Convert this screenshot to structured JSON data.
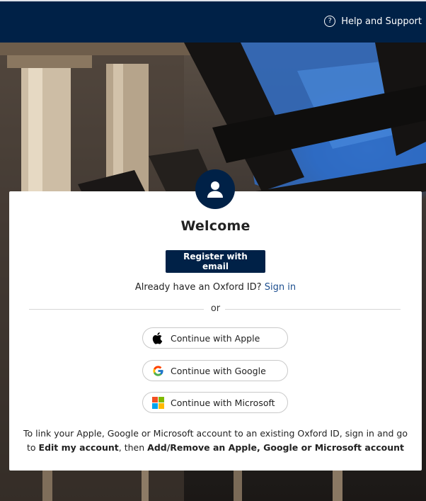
{
  "header": {
    "help_label": "Help and Support",
    "background_color": "#002147"
  },
  "hero": {
    "description": "Photo background of stone columns and iron railings",
    "sky_color": "#2a63b8"
  },
  "card": {
    "title": "Welcome",
    "register_label": "Register with email",
    "signin_prompt": "Already have an Oxford ID?",
    "signin_link": "Sign in",
    "or_label": "or",
    "providers": [
      {
        "label": "Continue with Apple",
        "icon": "apple-icon"
      },
      {
        "label": "Continue with Google",
        "icon": "google-icon"
      },
      {
        "label": "Continue with Microsoft",
        "icon": "microsoft-icon"
      }
    ],
    "note": {
      "prefix": "To link your Apple, Google or Microsoft account to an existing Oxford ID, sign in and go to",
      "edit_account": "Edit my account",
      "middle": ", then",
      "add_remove": "Add/Remove an Apple, Google or Microsoft account"
    }
  },
  "colors": {
    "brand": "#002147",
    "link": "#1d4f8f"
  }
}
